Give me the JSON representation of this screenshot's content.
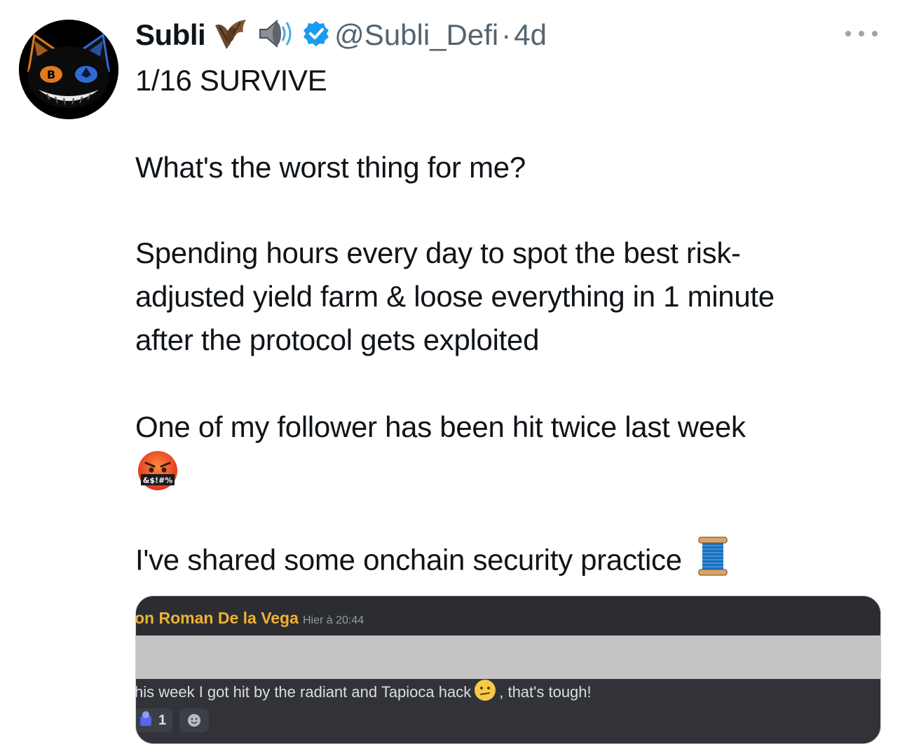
{
  "tweet": {
    "display_name": "Subli",
    "handle": "@Subli_Defi",
    "separator": "·",
    "time": "4d",
    "name_emojis": [
      "bat-emoji",
      "speaker-emoji"
    ],
    "verified_color": "#1d9bf0",
    "lines": {
      "l1": "1/16 SURVIVE",
      "l2": "What's the worst thing for me?",
      "l3": "Spending hours every day to spot the best risk-",
      "l4": "adjusted yield farm & loose everything in 1 minute",
      "l5": "after the protocol gets exploited",
      "l6": "One of my follower has been hit twice last week",
      "l7": "I've shared some onchain security practice"
    },
    "emoji_symbols": "&$!#%"
  },
  "attachment": {
    "author": "on Roman De la Vega",
    "timestamp": "Hier à 20:44",
    "message_before": "his week I got hit by the radiant and Tapioca hack",
    "message_after": ", that's tough!",
    "reaction_count": "1",
    "author_color": "#f0b232"
  }
}
